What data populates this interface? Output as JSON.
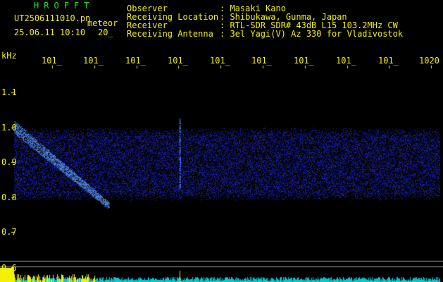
{
  "header": {
    "logo": "HROFFT",
    "filename": "UT2506111010.pn",
    "type": "meteor",
    "datetime": "25.06.11 10:10",
    "duration": "20_"
  },
  "info": {
    "observer_label": "Observer",
    "observer_value": ": Masaki Kano",
    "location_label": "Receiving Location",
    "location_value": ": Shibukawa, Gunma, Japan",
    "receiver_label": "Receiver",
    "receiver_value": ": RTL-SDR SDR# 43dB L15 103.2MHz CW",
    "antenna_label": "Receiving Antenna",
    "antenna_value": ": 3el Yagi(V) Az 330 for Vladivostok"
  },
  "axis": {
    "unit": "kHz",
    "time_ticks": [
      "101_",
      "101_",
      "101_",
      "101_",
      "101_",
      "101_",
      "101_",
      "101_",
      "101_",
      "1020"
    ],
    "freq_ticks": [
      "1.1",
      "1.0",
      "0.9",
      "0.8",
      "0.7",
      "0.6"
    ]
  },
  "colors": {
    "text": "#f2f200",
    "logo": "#20e020",
    "signal": "#2030c0",
    "meteor": "#60a0ff"
  }
}
